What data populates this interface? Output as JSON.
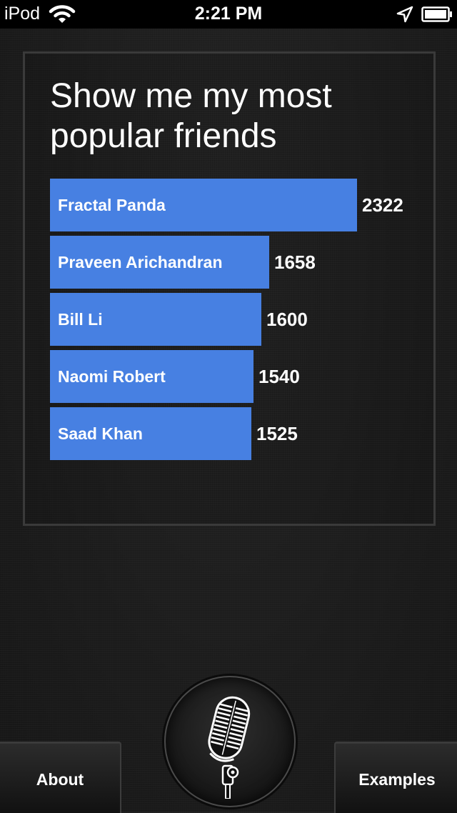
{
  "status_bar": {
    "carrier": "iPod",
    "time": "2:21 PM",
    "icons": [
      "wifi-icon",
      "location-arrow-icon",
      "battery-icon"
    ]
  },
  "card": {
    "query": "Show me my most popular friends"
  },
  "chart_data": {
    "type": "bar",
    "orientation": "horizontal",
    "categories": [
      "Fractal Panda",
      "Praveen Arichandran",
      "Bill Li",
      "Naomi Robert",
      "Saad Khan"
    ],
    "values": [
      2322,
      1658,
      1600,
      1540,
      1525
    ],
    "bar_color": "#4780e2",
    "title": "",
    "xlabel": "",
    "ylabel": "",
    "grid": false
  },
  "buttons": {
    "about": "About",
    "examples": "Examples",
    "mic_icon": "microphone-icon"
  },
  "colors": {
    "background": "#1c1c1c",
    "bar": "#4780e2",
    "text": "#ffffff"
  }
}
